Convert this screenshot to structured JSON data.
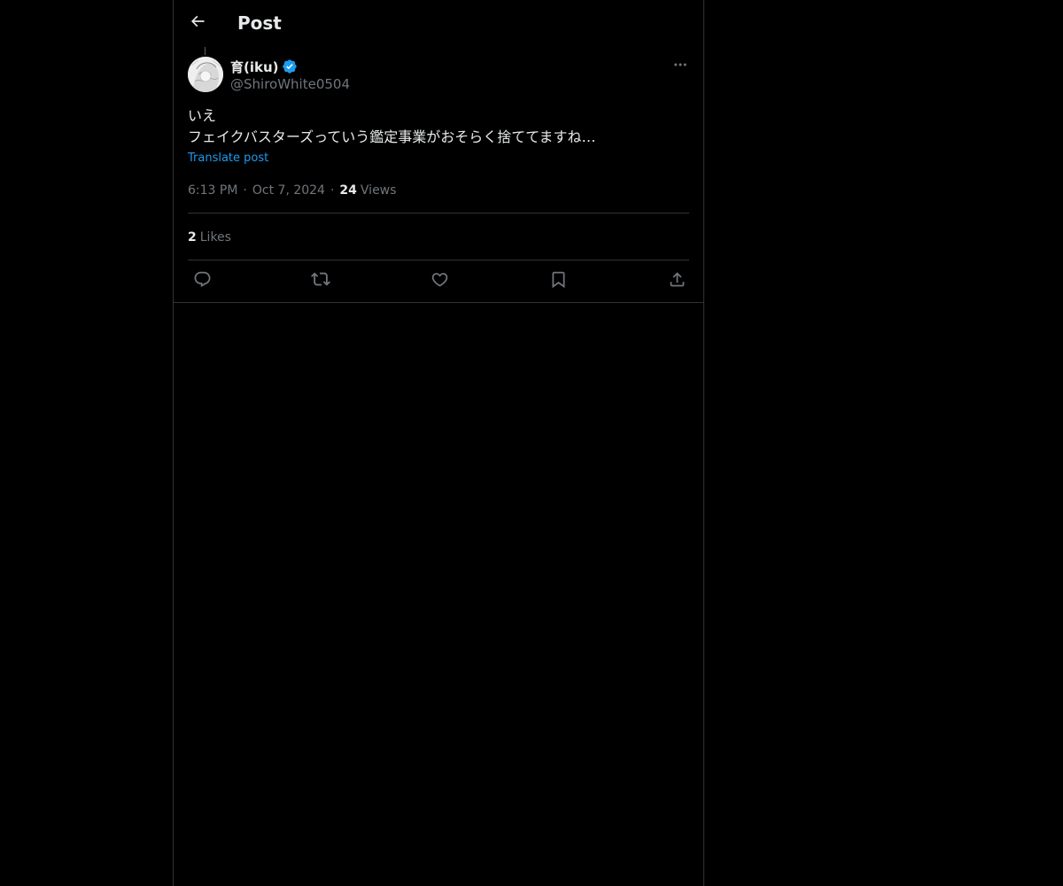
{
  "header": {
    "title": "Post"
  },
  "post": {
    "author": {
      "display_name": "育(iku)",
      "handle": "@ShiroWhite0504",
      "verified": true
    },
    "text_lines": [
      "いえ",
      "フェイクバスターズっていう鑑定事業がおそらく捨ててますね…"
    ],
    "translate_label": "Translate post",
    "time": "6:13 PM",
    "date": "Oct 7, 2024",
    "separator": "·",
    "views_count": "24",
    "views_label": "Views",
    "likes_count": "2",
    "likes_label": "Likes"
  },
  "actions": {
    "icons": [
      "reply-icon",
      "repost-icon",
      "like-icon",
      "bookmark-icon",
      "share-icon"
    ]
  },
  "colors": {
    "background": "#000000",
    "text_primary": "#e7e9ea",
    "text_secondary": "#71767b",
    "accent": "#1d9bf0",
    "border": "#2f3336"
  }
}
